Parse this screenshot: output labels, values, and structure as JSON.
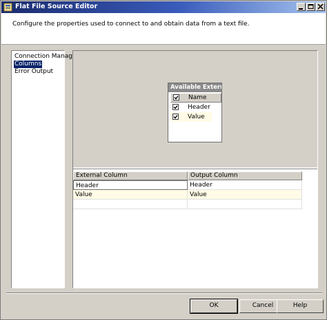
{
  "window": {
    "title": "Flat File Source Editor"
  },
  "header": {
    "description": "Configure the properties used to connect to and obtain data from a text file."
  },
  "nav": {
    "items": [
      {
        "label": "Connection Manager",
        "selected": false
      },
      {
        "label": "Columns",
        "selected": true
      },
      {
        "label": "Error Output",
        "selected": false
      }
    ]
  },
  "available_columns": {
    "title": "Available Extern...",
    "header_label": "Name",
    "header_checked": true,
    "rows": [
      {
        "label": "Header",
        "checked": true
      },
      {
        "label": "Value",
        "checked": true
      }
    ]
  },
  "mapping_grid": {
    "headers": [
      "External Column",
      "Output Column"
    ],
    "rows": [
      [
        "Header",
        "Header"
      ],
      [
        "Value",
        "Value"
      ]
    ]
  },
  "buttons": {
    "ok": "OK",
    "cancel": "Cancel",
    "help": "Help"
  },
  "colors": {
    "selected_row": "#fffbe6",
    "nav_selected": "#0a246a"
  }
}
